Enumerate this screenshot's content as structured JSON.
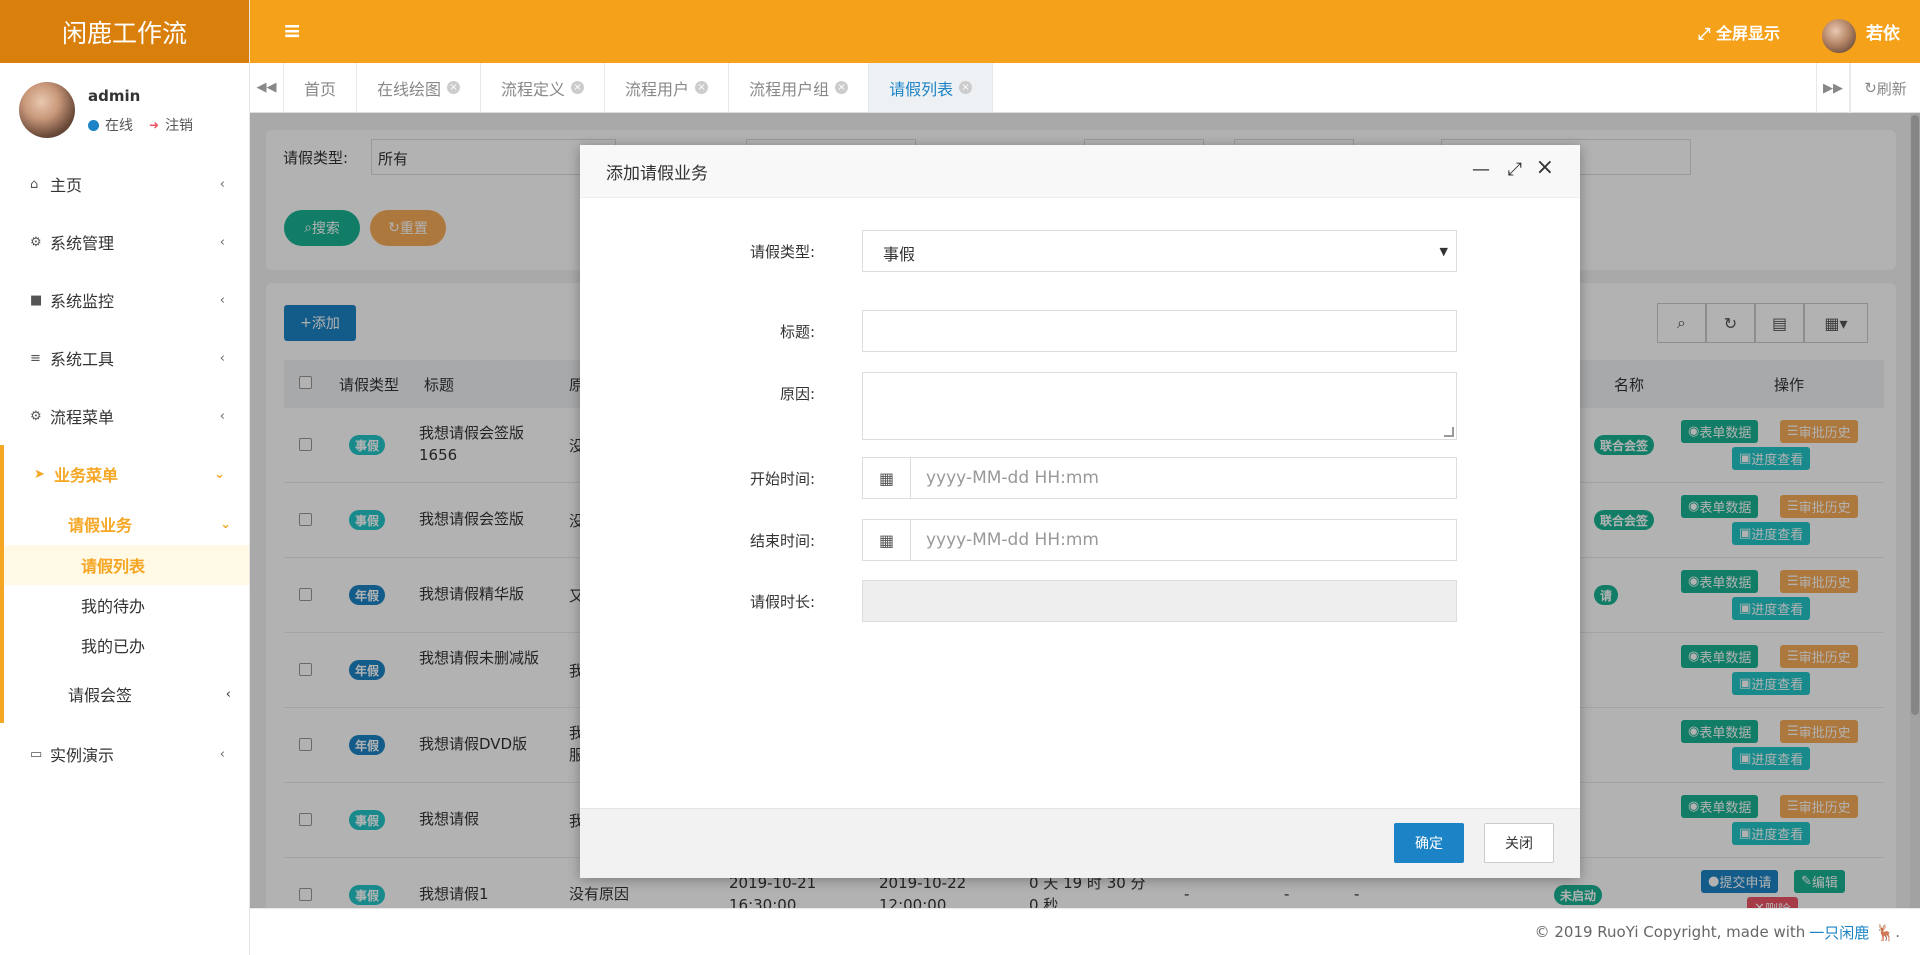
{
  "app": {
    "logo": "闲鹿工作流",
    "fullscreen_label": "全屏显示",
    "top_user": "若依"
  },
  "user": {
    "name": "admin",
    "status": "在线",
    "logout": "注销"
  },
  "sidebar": {
    "items": [
      {
        "label": "主页",
        "icon": "home-icon"
      },
      {
        "label": "系统管理",
        "icon": "gear-icon"
      },
      {
        "label": "系统监控",
        "icon": "video-icon"
      },
      {
        "label": "系统工具",
        "icon": "bars-icon"
      },
      {
        "label": "流程菜单",
        "icon": "cogs-icon"
      },
      {
        "label": "业务菜单",
        "icon": "paper-plane-icon"
      },
      {
        "label": "实例演示",
        "icon": "desktop-icon"
      }
    ],
    "sub_leave": "请假业务",
    "sub_leave_items": [
      "请假列表",
      "我的待办",
      "我的已办"
    ],
    "sub_sign": "请假会签"
  },
  "tabs": {
    "items": [
      "首页",
      "在线绘图",
      "流程定义",
      "流程用户",
      "流程用户组",
      "请假列表"
    ],
    "active": "请假列表",
    "refresh": "刷新"
  },
  "filter": {
    "type_label": "请假类型:",
    "type_value": "所有",
    "search": "搜索",
    "reset": "重置"
  },
  "table": {
    "add": "添加",
    "headers": {
      "type": "请假类型",
      "title": "标题",
      "reason": "原",
      "node": "名称",
      "ops": "操作"
    },
    "rows": [
      {
        "type": "事假",
        "title": "我想请假会签版1656",
        "reason": "没"
      },
      {
        "type": "事假",
        "title": "我想请假会签版",
        "reason": "没"
      },
      {
        "type": "年假",
        "title": "我想请假精华版",
        "reason": "又"
      },
      {
        "type": "年假",
        "title": "我想请假未删减版",
        "reason": "我"
      },
      {
        "type": "年假",
        "title": "我想请假DVD版",
        "reason": "我服"
      },
      {
        "type": "事假",
        "title": "我想请假",
        "reason": "我"
      },
      {
        "type": "事假",
        "title": "我想请假1",
        "reason": "没有原因",
        "start": "2019-10-21 16:30:00",
        "end": "2019-10-22 12:00:00",
        "duration": "0 天 19 时 30 分 0 秒",
        "c1": "-",
        "c2": "-",
        "c3": "-",
        "status": "未启动"
      }
    ],
    "node_badges": [
      "联合会签",
      "联合会签",
      "请",
      "",
      "",
      ""
    ],
    "ops": {
      "form": "表单数据",
      "history": "审批历史",
      "progress": "进度查看",
      "submit": "提交申请",
      "edit": "编辑",
      "delete": "删除"
    }
  },
  "modal": {
    "title": "添加请假业务",
    "fields": {
      "type_label": "请假类型:",
      "type_value": "事假",
      "title_label": "标题:",
      "reason_label": "原因:",
      "start_label": "开始时间:",
      "start_placeholder": "yyyy-MM-dd HH:mm",
      "end_label": "结束时间:",
      "end_placeholder": "yyyy-MM-dd HH:mm",
      "duration_label": "请假时长:"
    },
    "ok": "确定",
    "close": "关闭"
  },
  "footer": {
    "copyright": "© 2019 RuoYi Copyright, made with",
    "link": "一只闲鹿",
    "tail": "."
  },
  "colors": {
    "brand": "#f5a11a",
    "logo_bg": "#d97f0b",
    "primary": "#1c84c6",
    "success": "#1ab394",
    "info": "#23c6c8",
    "warning": "#f8ac59"
  }
}
